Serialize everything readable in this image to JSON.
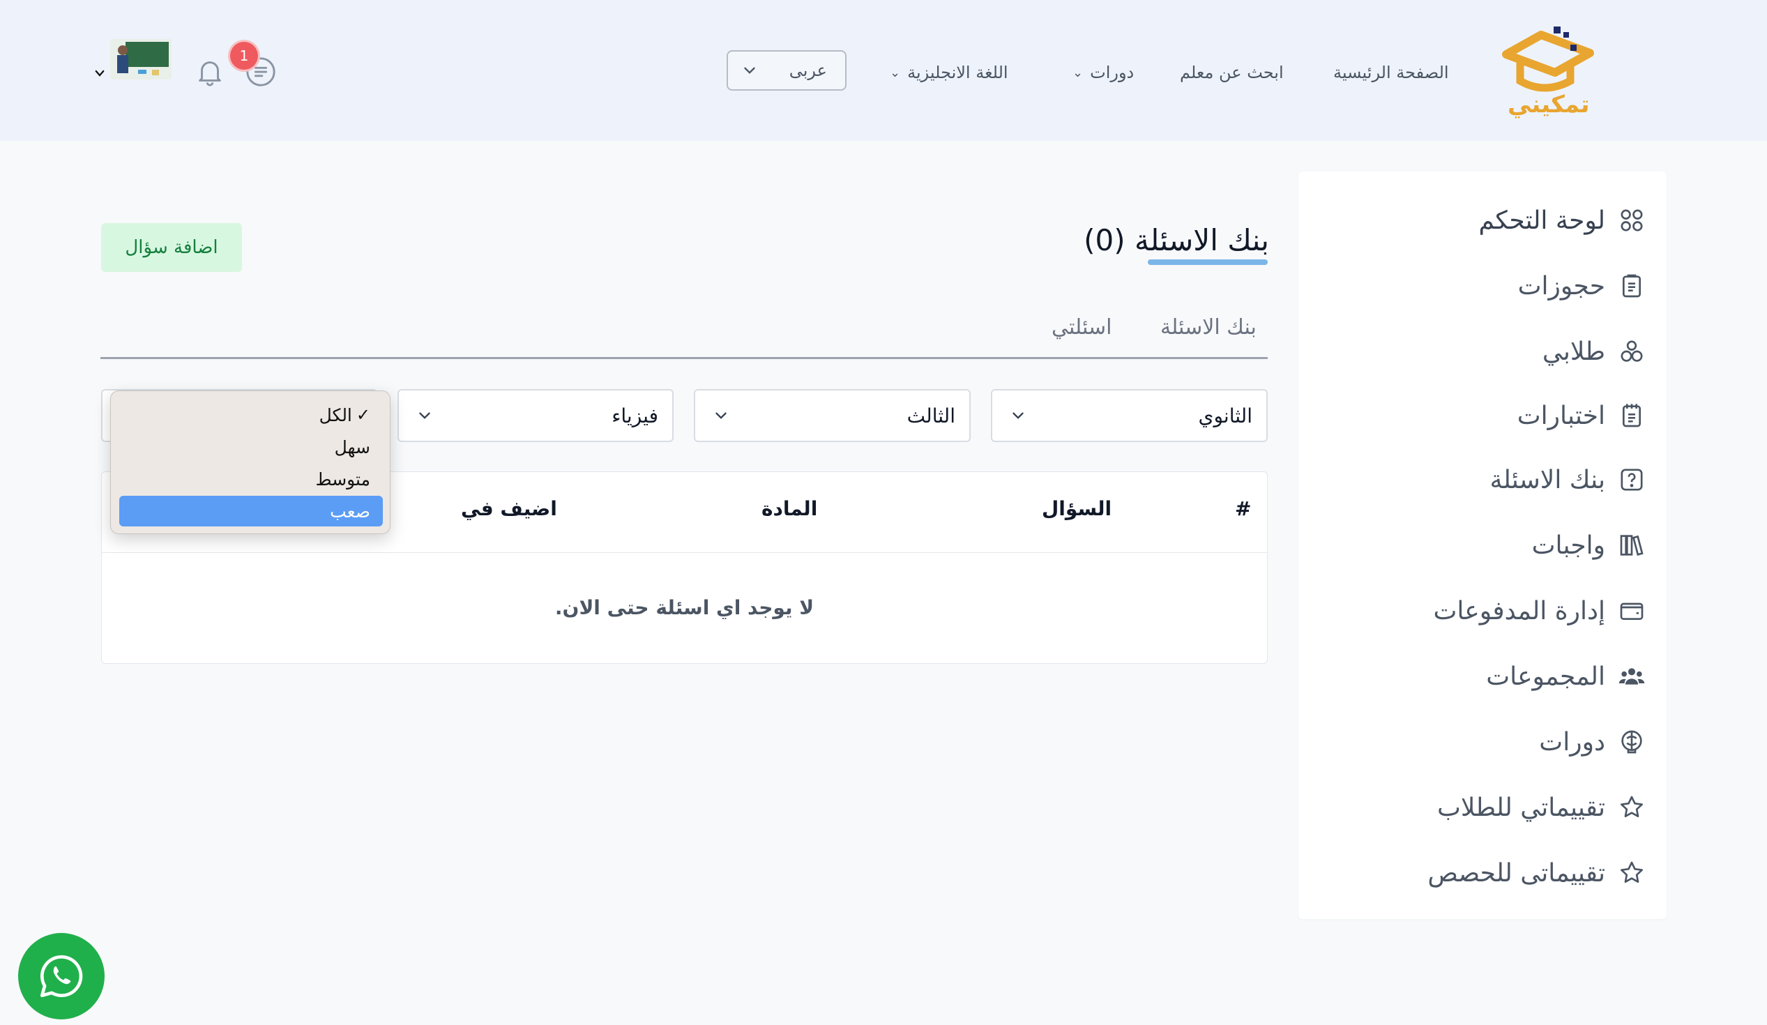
{
  "brand": {
    "logo_text": "تمكيني",
    "color": "#e8a530"
  },
  "header": {
    "nav": [
      {
        "label": "الصفحة الرئيسية",
        "has_caret": false
      },
      {
        "label": "ابحث عن معلم",
        "has_caret": false
      },
      {
        "label": "دورات",
        "has_caret": true
      },
      {
        "label": "اللغة الانجليزية",
        "has_caret": true
      }
    ],
    "language": "عربى",
    "messages_badge": "1"
  },
  "sidebar": {
    "items": [
      {
        "label": "لوحة التحكم",
        "icon": "grid-icon"
      },
      {
        "label": "حجوزات",
        "icon": "clipboard-icon"
      },
      {
        "label": "طلابي",
        "icon": "users-icon"
      },
      {
        "label": "اختبارات",
        "icon": "notepad-icon"
      },
      {
        "label": "بنك الاسئلة",
        "icon": "question-icon"
      },
      {
        "label": "واجبات",
        "icon": "books-icon"
      },
      {
        "label": "إدارة المدفوعات",
        "icon": "wallet-icon"
      },
      {
        "label": "المجموعات",
        "icon": "group-icon"
      },
      {
        "label": "دورات",
        "icon": "course-icon"
      },
      {
        "label": "تقييماتي للطلاب",
        "icon": "star-icon"
      },
      {
        "label": "تقييماتى للحصص",
        "icon": "star-icon"
      }
    ]
  },
  "main": {
    "title": "بنك الاسئلة (0)",
    "add_button": "اضافة سؤال",
    "tabs": [
      "بنك الاسئلة",
      "اسئلتي"
    ],
    "filters": {
      "stage": "الثانوي",
      "grade": "الثالث",
      "subject": "فيزياء"
    },
    "table": {
      "headers": [
        "#",
        "السؤال",
        "المادة",
        "اضيف في"
      ],
      "empty_message": "لا يوجد اي اسئلة حتى الان."
    }
  },
  "difficulty_dropdown": {
    "options": [
      "الكل",
      "سهل",
      "متوسط",
      "صعب"
    ],
    "checked": "الكل",
    "highlighted": "صعب"
  }
}
